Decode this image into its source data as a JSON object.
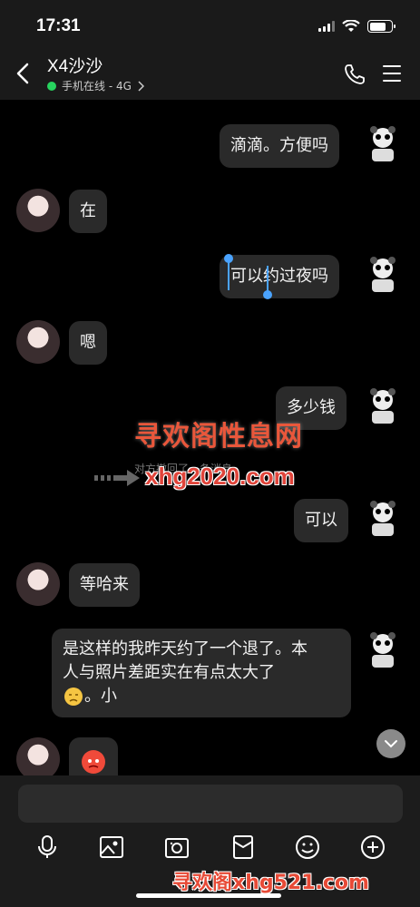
{
  "status_bar": {
    "time": "17:31"
  },
  "header": {
    "contact_name": "X4沙沙",
    "contact_status": "手机在线 - 4G",
    "online_color": "#27d35e"
  },
  "messages": [
    {
      "side": "right",
      "text": "滴滴。方便吗"
    },
    {
      "side": "left",
      "text": "在"
    },
    {
      "side": "right",
      "text": "可以约过夜吗"
    },
    {
      "side": "left",
      "text": "嗯"
    },
    {
      "side": "right",
      "text": "多少钱"
    },
    {
      "side": "right",
      "text": "可以"
    },
    {
      "side": "left",
      "text": "等哈来"
    },
    {
      "side": "right",
      "text_line1": "是这样的我昨天约了一个退了。本",
      "text_line2": "人与照片差距实在有点太大了",
      "text_line3": "。小"
    },
    {
      "side": "left",
      "text": ""
    }
  ],
  "recall_notice": "对方撤回了一条消息",
  "watermarks": {
    "line1": "寻欢阁性息网",
    "line2": "xhg2020.com",
    "line3": "寻欢阁xhg521.com"
  },
  "input": {
    "placeholder": ""
  },
  "toolbar": {
    "icons": [
      "microphone-icon",
      "image-icon",
      "camera-icon",
      "red-packet-icon",
      "emoji-icon",
      "plus-icon"
    ]
  }
}
